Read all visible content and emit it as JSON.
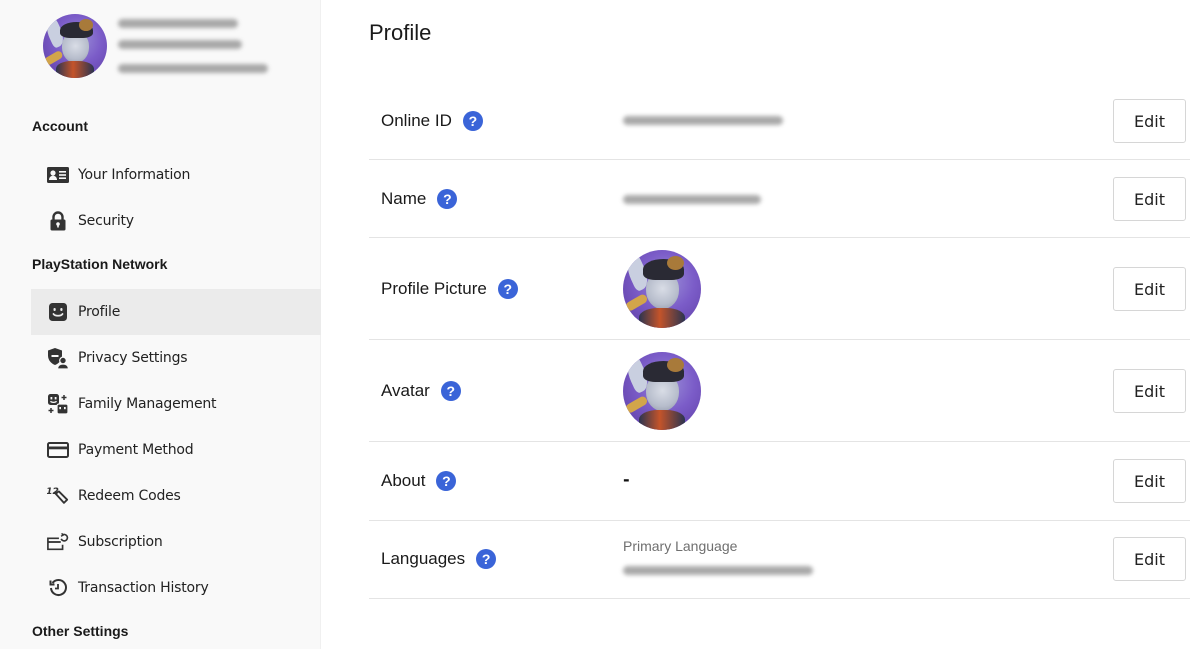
{
  "sidebar": {
    "user": {
      "avatar_alt": "profile-avatar",
      "name_redacted": true,
      "details_redacted": true
    },
    "sections": [
      {
        "title": "Account",
        "items": [
          {
            "label": "Your Information",
            "icon": "id-card-icon"
          },
          {
            "label": "Security",
            "icon": "lock-icon"
          }
        ]
      },
      {
        "title": "PlayStation Network",
        "items": [
          {
            "label": "Profile",
            "icon": "smiley-face-icon",
            "active": true
          },
          {
            "label": "Privacy Settings",
            "icon": "shield-person-icon"
          },
          {
            "label": "Family Management",
            "icon": "family-icon"
          },
          {
            "label": "Payment Method",
            "icon": "credit-card-icon"
          },
          {
            "label": "Redeem Codes",
            "icon": "redeem-code-icon"
          },
          {
            "label": "Subscription",
            "icon": "subscription-icon"
          },
          {
            "label": "Transaction History",
            "icon": "history-icon"
          }
        ]
      },
      {
        "title": "Other Settings",
        "items": []
      }
    ]
  },
  "main": {
    "title": "Profile",
    "rows": [
      {
        "label": "Online ID",
        "value": "[redacted]",
        "edit": "Edit"
      },
      {
        "label": "Name",
        "value": "[redacted]",
        "edit": "Edit"
      },
      {
        "label": "Profile Picture",
        "value": "profile-picture-image",
        "edit": "Edit"
      },
      {
        "label": "Avatar",
        "value": "avatar-image",
        "edit": "Edit"
      },
      {
        "label": "About",
        "value": "-",
        "edit": "Edit"
      },
      {
        "label": "Languages",
        "caption": "Primary Language",
        "value": "[redacted]",
        "edit": "Edit"
      }
    ],
    "help_glyph": "?"
  },
  "colors": {
    "accent": "#3a64d8",
    "sidebar_bg": "#f9f9f9",
    "active_bg": "#ebebeb",
    "divider": "#e4e4e4"
  }
}
